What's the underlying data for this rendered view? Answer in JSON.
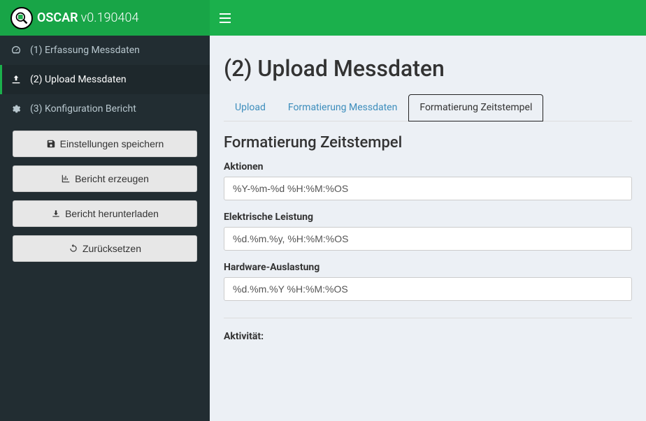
{
  "app": {
    "name": "OSCAR",
    "version": "v0.190404"
  },
  "sidebar": {
    "items": [
      {
        "label": "(1) Erfassung Messdaten",
        "active": false
      },
      {
        "label": "(2) Upload Messdaten",
        "active": true
      },
      {
        "label": "(3) Konfiguration Bericht",
        "active": false
      }
    ],
    "buttons": [
      {
        "label": "Einstellungen speichern"
      },
      {
        "label": "Bericht erzeugen"
      },
      {
        "label": "Bericht herunterladen"
      },
      {
        "label": "Zurücksetzen"
      }
    ]
  },
  "page": {
    "title": "(2) Upload Messdaten",
    "tabs": [
      {
        "label": "Upload",
        "active": false
      },
      {
        "label": "Formatierung Messdaten",
        "active": false
      },
      {
        "label": "Formatierung Zeitstempel",
        "active": true
      }
    ],
    "section_title": "Formatierung Zeitstempel",
    "fields": [
      {
        "label": "Aktionen",
        "value": "%Y-%m-%d %H:%M:%OS"
      },
      {
        "label": "Elektrische Leistung",
        "value": "%d.%m.%y, %H:%M:%OS"
      },
      {
        "label": "Hardware-Auslastung",
        "value": "%d.%m.%Y %H:%M:%OS"
      }
    ],
    "activity_label": "Aktivität:"
  }
}
